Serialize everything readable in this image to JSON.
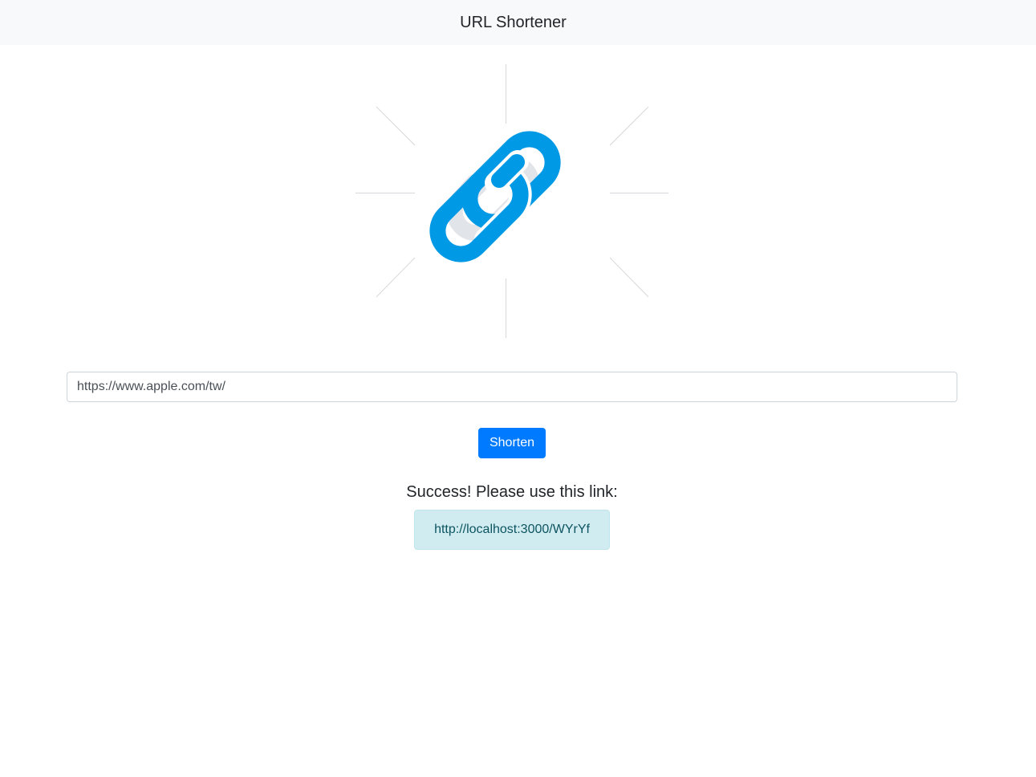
{
  "header": {
    "title": "URL Shortener"
  },
  "logo": {
    "icon": "link-chain-icon",
    "color": "#0099e5",
    "shadow_color": "#e1e4e8"
  },
  "form": {
    "url_value": "https://www.apple.com/tw/",
    "submit_label": "Shorten"
  },
  "result": {
    "heading": "Success! Please use this link:",
    "short_link": "http://localhost:3000/WYrYf"
  },
  "colors": {
    "primary": "#007bff",
    "alert_info_bg": "#d1ecf1",
    "alert_info_text": "#0c5460",
    "navbar_bg": "#f8f9fa"
  }
}
